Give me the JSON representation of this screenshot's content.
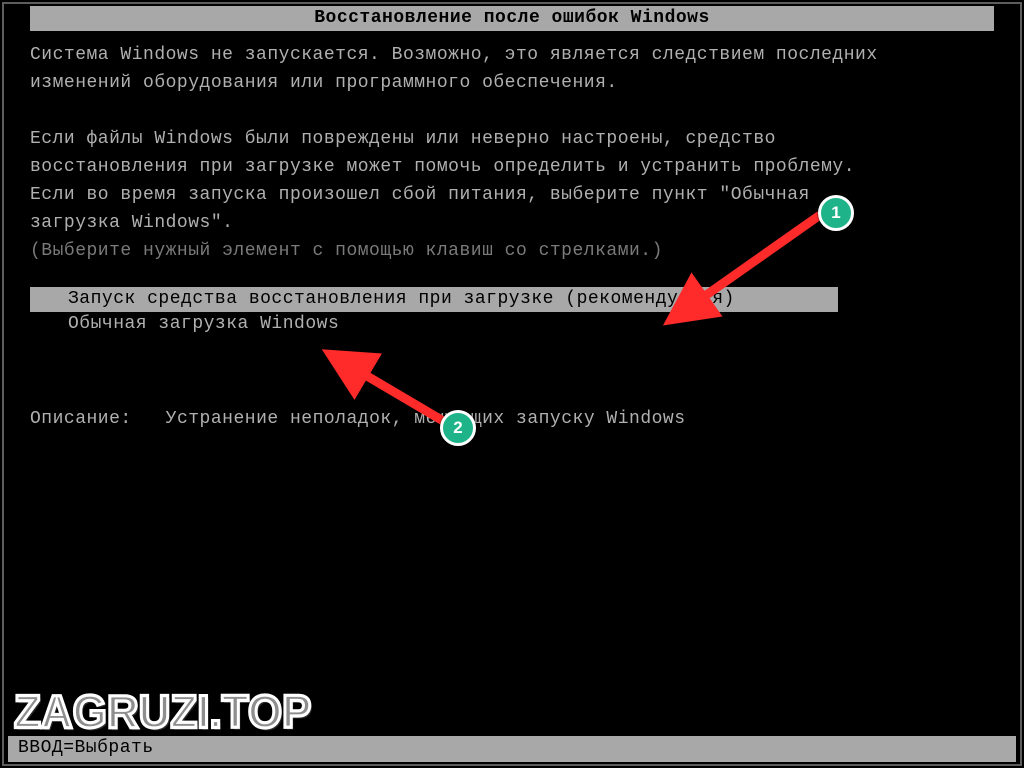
{
  "title": "Восстановление после ошибок Windows",
  "paragraph1a": "Система Windows не запускается. Возможно, это является следствием последних",
  "paragraph1b": "изменений оборудования или программного обеспечения.",
  "paragraph2a": "Если файлы Windows были повреждены или неверно настроены, средство",
  "paragraph2b": "восстановления при загрузке может помочь определить и устранить проблему.",
  "paragraph2c": "Если во время запуска произошел сбой питания, выберите пункт \"Обычная",
  "paragraph2d": "загрузка Windows\".",
  "hint": "(Выберите нужный элемент с помощью клавиш со стрелками.)",
  "menu": {
    "option1": "Запуск средства восстановления при загрузке (рекомендуется)",
    "option2": "Обычная загрузка Windows"
  },
  "description_label": "Описание:",
  "description_value": "Устранение неполадок, мешающих запуску Windows",
  "footer": "ВВОД=Выбрать",
  "annotations": {
    "badge1": "1",
    "badge2": "2"
  },
  "watermark": "ZAGRUZI.TOP"
}
